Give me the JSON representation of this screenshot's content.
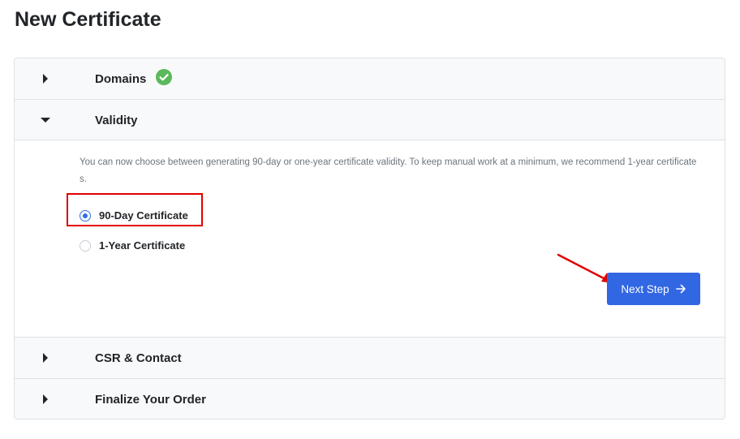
{
  "page": {
    "title": "New Certificate"
  },
  "accordion": {
    "sections": [
      {
        "title": "Domains",
        "state": "collapsed",
        "completed": true
      },
      {
        "title": "Validity",
        "state": "expanded"
      },
      {
        "title": "CSR & Contact",
        "state": "collapsed"
      },
      {
        "title": "Finalize Your Order",
        "state": "collapsed"
      }
    ],
    "validity": {
      "description": "You can now choose between generating 90-day or one-year certificate validity. To keep manual work at a minimum, we recommend 1-year certificates.",
      "options": [
        {
          "label": "90-Day Certificate",
          "selected": true
        },
        {
          "label": "1-Year Certificate",
          "selected": false
        }
      ],
      "next_label": "Next Step"
    }
  },
  "colors": {
    "accent": "#3267e3",
    "success": "#5cb85c",
    "annotation_red": "#e00000"
  },
  "icons": {
    "collapsed": "caret-right-icon",
    "expanded": "caret-down-icon",
    "completed": "check-circle-icon",
    "next": "arrow-right-icon"
  }
}
